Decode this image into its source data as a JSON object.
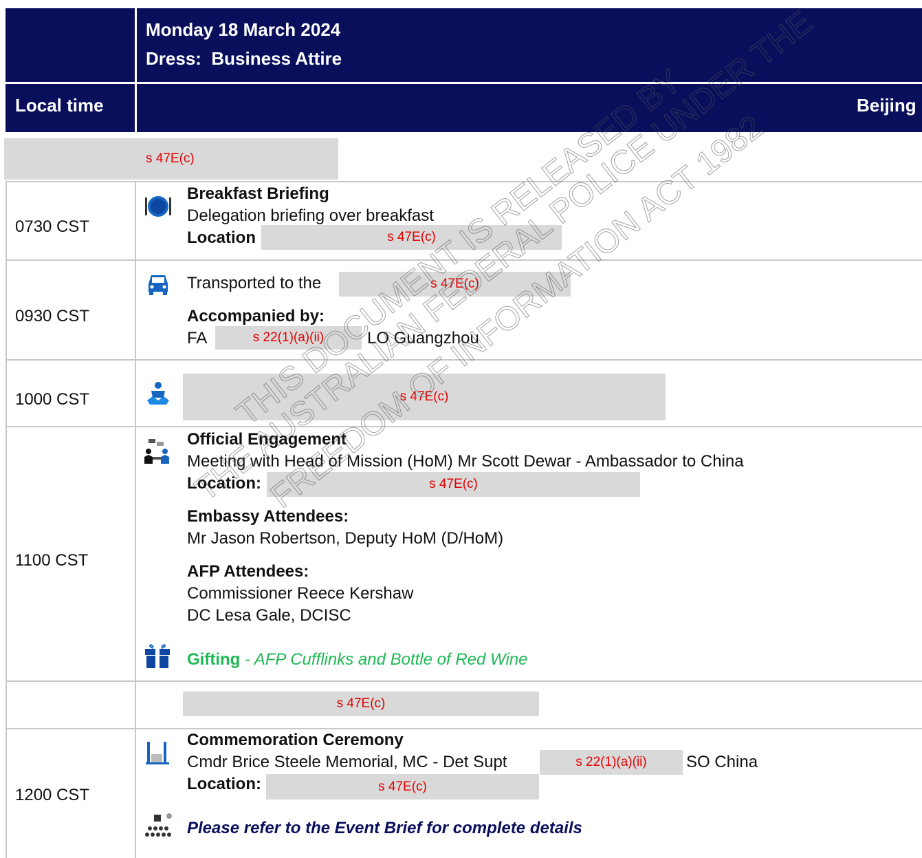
{
  "header": {
    "date": "Monday 18 March 2024",
    "dress": "Dress:  Business Attire",
    "col_time": "Local time",
    "col_location": "Beijing"
  },
  "redaction_47": "s 47E(c)",
  "redaction_22": "s 22(1)(a)(ii)",
  "rows": {
    "breakfast": {
      "time": "0730 CST",
      "title": "Breakfast Briefing",
      "desc": "Delegation briefing over breakfast",
      "location_label": "Location"
    },
    "transport": {
      "time": "0930 CST",
      "text": "Transported to the",
      "accompanied_label": "Accompanied by:",
      "fa_prefix": "FA",
      "fa_suffix": "LO Guangzhou"
    },
    "meeting": {
      "time": "1000 CST"
    },
    "official": {
      "time": "1100 CST",
      "title": "Official Engagement",
      "desc": "Meeting with Head of Mission (HoM) Mr Scott Dewar - Ambassador to China",
      "location_label": "Location:",
      "embassy_label": "Embassy Attendees:",
      "embassy_1": "Mr Jason Robertson, Deputy HoM (D/HoM)",
      "afp_label": "AFP Attendees:",
      "afp_1": "Commissioner Reece Kershaw",
      "afp_2": "DC Lesa Gale, DCISC",
      "gift_label": "Gifting",
      "gift_detail": " - AFP Cufflinks and Bottle of Red Wine"
    },
    "ceremony": {
      "time": "1200 CST",
      "title": "Commemoration Ceremony",
      "desc": "Cmdr Brice Steele Memorial, MC - Det Supt",
      "desc_suffix": "SO China",
      "location_label": "Location:",
      "note": "Please refer to the Event Brief for complete details"
    }
  },
  "watermark": {
    "line1": "THIS DOCUMENT IS RELEASED BY",
    "line2": "THE AUSTRALIAN FEDERAL POLICE UNDER THE",
    "line3": "FREEDOM OF INFORMATION ACT 1982"
  },
  "colors": {
    "header_bg": "#0a0f5c",
    "redaction_bg": "#d9d9d9",
    "redaction_text": "#e60000",
    "gift_green": "#1db954",
    "note_blue": "#0a0f5c",
    "icon_blue": "#1565c0"
  }
}
